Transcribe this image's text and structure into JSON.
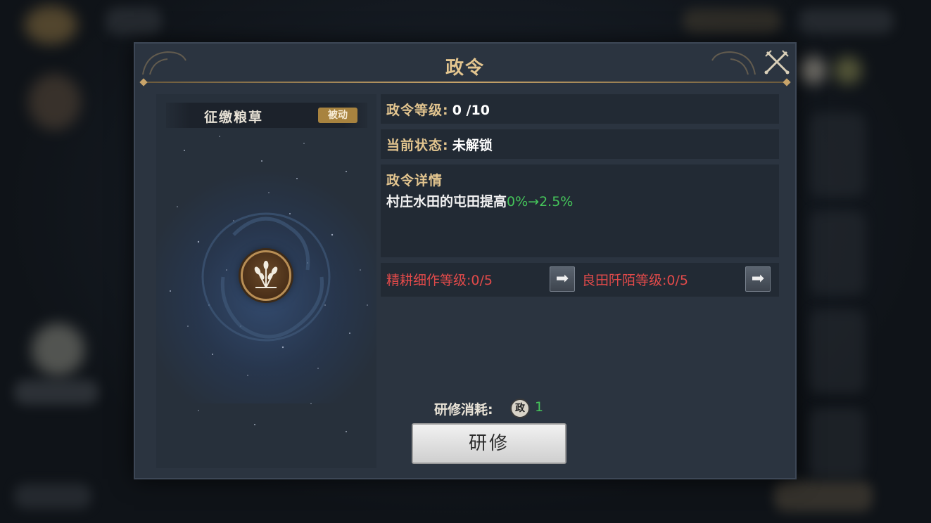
{
  "dialog": {
    "title": "政令",
    "close_icon": "crossed-swords-icon"
  },
  "skill": {
    "name": "征缴粮草",
    "type_badge": "被动",
    "icon": "wheat-icon"
  },
  "level_row": {
    "label": "政令等级:",
    "current": "0",
    "max": " /10"
  },
  "status_row": {
    "label": "当前状态:",
    "value": "未解锁"
  },
  "details": {
    "title": "政令详情",
    "desc": "村庄水田的屯田提高",
    "change": "0%→2.5%"
  },
  "requirements": [
    {
      "text": "精耕细作等级:0/5",
      "button_icon": "arrow-right-icon"
    },
    {
      "text": "良田阡陌等级:0/5",
      "button_icon": "arrow-right-icon"
    }
  ],
  "cost": {
    "label": "研修消耗:",
    "icon_char": "政",
    "value": "1"
  },
  "study_button": "研修",
  "colors": {
    "gold": "#e3c58f",
    "green": "#45c45a",
    "red": "#e24a4a",
    "panel": "#2b3440"
  }
}
